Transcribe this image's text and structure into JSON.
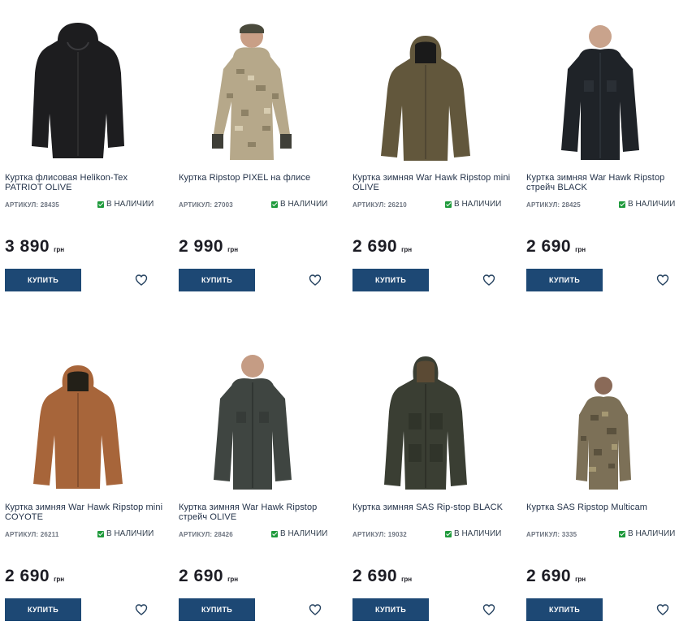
{
  "currency": "грн",
  "buy_label": "КУПИТЬ",
  "sku_prefix": "АРТИКУЛ:",
  "stock_label": "В НАЛИЧИИ",
  "colors": {
    "buy_button": "#1d4874",
    "in_stock_check": "#1e9a3b"
  },
  "products": [
    {
      "title": "Куртка флисовая Helikon-Tex PATRIOT OLIVE",
      "sku": "АРТИКУЛ: 28435",
      "stock": "В НАЛИЧИИ",
      "price": "3 890",
      "currency": "грн",
      "buy": "КУПИТЬ",
      "icon": "heart-icon"
    },
    {
      "title": "Куртка Ripstop PIXEL на флисе",
      "sku": "АРТИКУЛ: 27003",
      "stock": "В НАЛИЧИИ",
      "price": "2 990",
      "currency": "грн",
      "buy": "КУПИТЬ",
      "icon": "heart-icon"
    },
    {
      "title": "Куртка зимняя War Hawk Ripstop mini OLIVE",
      "sku": "АРТИКУЛ: 26210",
      "stock": "В НАЛИЧИИ",
      "price": "2 690",
      "currency": "грн",
      "buy": "КУПИТЬ",
      "icon": "heart-icon"
    },
    {
      "title": "Куртка зимняя War Hawk Ripstop стрейч BLACK",
      "sku": "АРТИКУЛ: 28425",
      "stock": "В НАЛИЧИИ",
      "price": "2 690",
      "currency": "грн",
      "buy": "КУПИТЬ",
      "icon": "heart-icon"
    },
    {
      "title": "Куртка зимняя War Hawk Ripstop mini COYOTE",
      "sku": "АРТИКУЛ: 26211",
      "stock": "В НАЛИЧИИ",
      "price": "2 690",
      "currency": "грн",
      "buy": "КУПИТЬ",
      "icon": "heart-icon"
    },
    {
      "title": "Куртка зимняя War Hawk Ripstop стрейч OLIVE",
      "sku": "АРТИКУЛ: 28426",
      "stock": "В НАЛИЧИИ",
      "price": "2 690",
      "currency": "грн",
      "buy": "КУПИТЬ",
      "icon": "heart-icon"
    },
    {
      "title": "Куртка зимняя SAS Rip-stop BLACK",
      "sku": "АРТИКУЛ: 19032",
      "stock": "В НАЛИЧИИ",
      "price": "2 690",
      "currency": "грн",
      "buy": "КУПИТЬ",
      "icon": "heart-icon"
    },
    {
      "title": "Куртка SAS Ripstop Multicam",
      "sku": "АРТИКУЛ: 3335",
      "stock": "В НАЛИЧИИ",
      "price": "2 690",
      "currency": "грн",
      "buy": "КУПИТЬ",
      "icon": "heart-icon"
    }
  ]
}
